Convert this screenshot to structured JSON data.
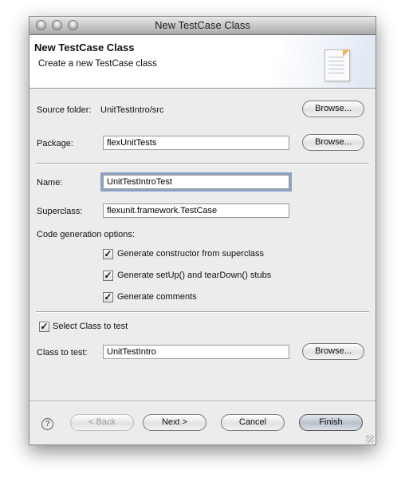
{
  "window": {
    "title": "New TestCase Class"
  },
  "header": {
    "title": "New TestCase Class",
    "subtitle": "Create a new TestCase class",
    "icon": "document-icon"
  },
  "form": {
    "source_folder_label": "Source folder:",
    "source_folder_value": "UnitTestIntro/src",
    "package_label": "Package:",
    "package_value": "flexUnitTests",
    "name_label": "Name:",
    "name_value": "UnitTestIntroTest",
    "superclass_label": "Superclass:",
    "superclass_value": "flexunit.framework.TestCase",
    "codegen_label": "Code generation options:",
    "options": [
      {
        "label": "Generate constructor from superclass",
        "checked": true
      },
      {
        "label": "Generate setUp() and tearDown() stubs",
        "checked": true
      },
      {
        "label": "Generate comments",
        "checked": true
      }
    ],
    "select_class_label": "Select Class to test",
    "select_class_checked": true,
    "class_to_test_label": "Class to test:",
    "class_to_test_value": "UnitTestIntro",
    "browse_label": "Browse..."
  },
  "footer": {
    "help": "?",
    "back": "< Back",
    "next": "Next >",
    "cancel": "Cancel",
    "finish": "Finish"
  }
}
